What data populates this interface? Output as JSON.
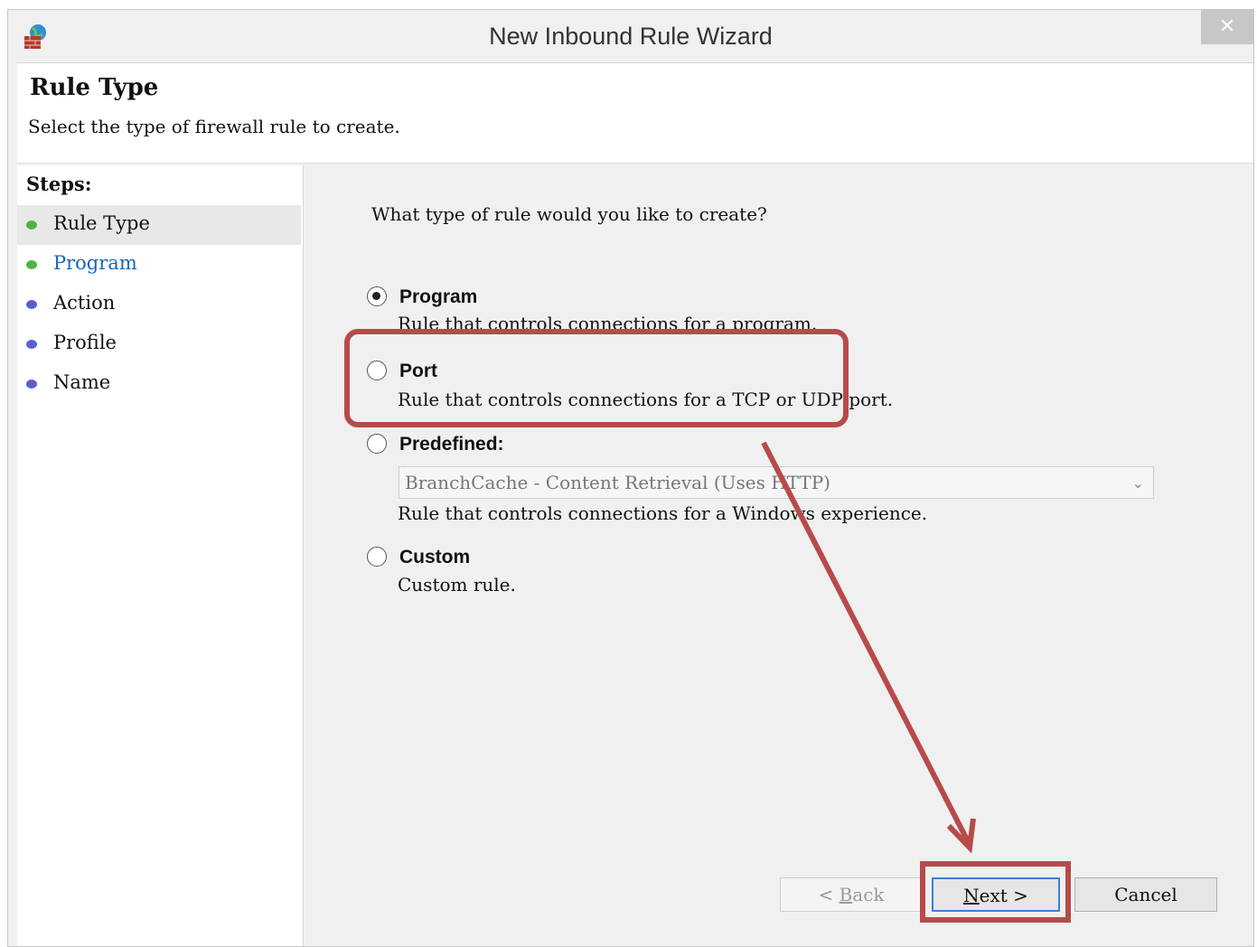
{
  "window": {
    "title": "New Inbound Rule Wizard",
    "close_glyph": "✕",
    "app_icon": "firewall-globe-icon"
  },
  "header": {
    "title": "Rule Type",
    "subtitle": "Select the type of firewall rule to create."
  },
  "steps": {
    "label": "Steps:",
    "items": [
      {
        "label": "Rule Type",
        "state": "current"
      },
      {
        "label": "Program",
        "state": "link"
      },
      {
        "label": "Action",
        "state": "pending"
      },
      {
        "label": "Profile",
        "state": "pending"
      },
      {
        "label": "Name",
        "state": "pending"
      }
    ]
  },
  "main": {
    "question": "What type of rule would you like to create?",
    "options": [
      {
        "label": "Program",
        "description": "Rule that controls connections for a program.",
        "checked": true
      },
      {
        "label": "Port",
        "description": "Rule that controls connections for a TCP or UDP port.",
        "checked": false
      },
      {
        "label": "Predefined:",
        "description": "Rule that controls connections for a Windows experience.",
        "checked": false
      },
      {
        "label": "Custom",
        "description": "Custom rule.",
        "checked": false
      }
    ],
    "predefined_select": {
      "value": "BranchCache - Content Retrieval (Uses HTTP)",
      "icon": "chevron-down-icon"
    }
  },
  "buttons": {
    "back_prefix": "< ",
    "back_accel": "B",
    "back_rest": "ack",
    "next_accel": "N",
    "next_rest": "ext >",
    "cancel": "Cancel"
  },
  "colors": {
    "annotation": "#b84a4a",
    "step_done": "#4cb548",
    "step_pending": "#5a5fd0",
    "link": "#1565c0",
    "focus_border": "#3c7fd9"
  }
}
